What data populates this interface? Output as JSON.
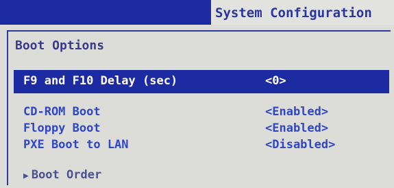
{
  "menu": {
    "active_tab": "System Configuration"
  },
  "panel": {
    "title": "Boot Options",
    "selected_item": {
      "label": "F9 and F10 Delay (sec)",
      "value": "<0>"
    },
    "items": [
      {
        "label": "CD-ROM Boot",
        "value": "<Enabled>"
      },
      {
        "label": "Floppy Boot",
        "value": "<Enabled>"
      },
      {
        "label": "PXE Boot to LAN",
        "value": "<Disabled>"
      }
    ],
    "submenu": {
      "arrow": "▶",
      "label": "Boot Order"
    }
  },
  "colors": {
    "menubar_bg": "#1d2ba2",
    "screen_bg": "#dcdcd8",
    "item_text": "#2f46c8",
    "title_text": "#3a3a8a"
  }
}
